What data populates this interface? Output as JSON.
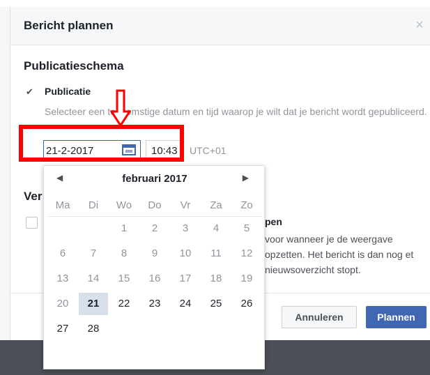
{
  "dialog": {
    "title": "Bericht plannen",
    "close_glyph": "×"
  },
  "schedule": {
    "heading": "Publicatieschema",
    "publication_label": "Publicatie",
    "publication_desc": "Selecteer een toekomstige datum en tijd waarop je wilt dat je bericht wordt gepubliceerd.",
    "date_value": "21-2-2017",
    "time_value": "10:43",
    "timezone": "UTC+01"
  },
  "visibility": {
    "heading_partial": "Ver",
    "label_partial": "pen",
    "desc_partial": "voor wanneer je de weergave opzetten. Het bericht is dan nog et nieuwsoverzicht stopt."
  },
  "calendar": {
    "prev_glyph": "◀",
    "next_glyph": "▶",
    "month": "februari 2017",
    "weekdays": [
      "Ma",
      "Di",
      "Wo",
      "Do",
      "Vr",
      "Za",
      "Zo"
    ],
    "weeks": [
      [
        "",
        "",
        "1",
        "2",
        "3",
        "4",
        "5"
      ],
      [
        "6",
        "7",
        "8",
        "9",
        "10",
        "11",
        "12"
      ],
      [
        "13",
        "14",
        "15",
        "16",
        "17",
        "18",
        "19"
      ],
      [
        "20",
        "21",
        "22",
        "23",
        "24",
        "25",
        "26"
      ],
      [
        "27",
        "28",
        "",
        "",
        "",
        "",
        ""
      ]
    ],
    "selected_day": "21"
  },
  "buttons": {
    "cancel": "Annuleren",
    "plan": "Plannen"
  },
  "colors": {
    "accent": "#4267b2",
    "highlight": "#ff0000"
  }
}
